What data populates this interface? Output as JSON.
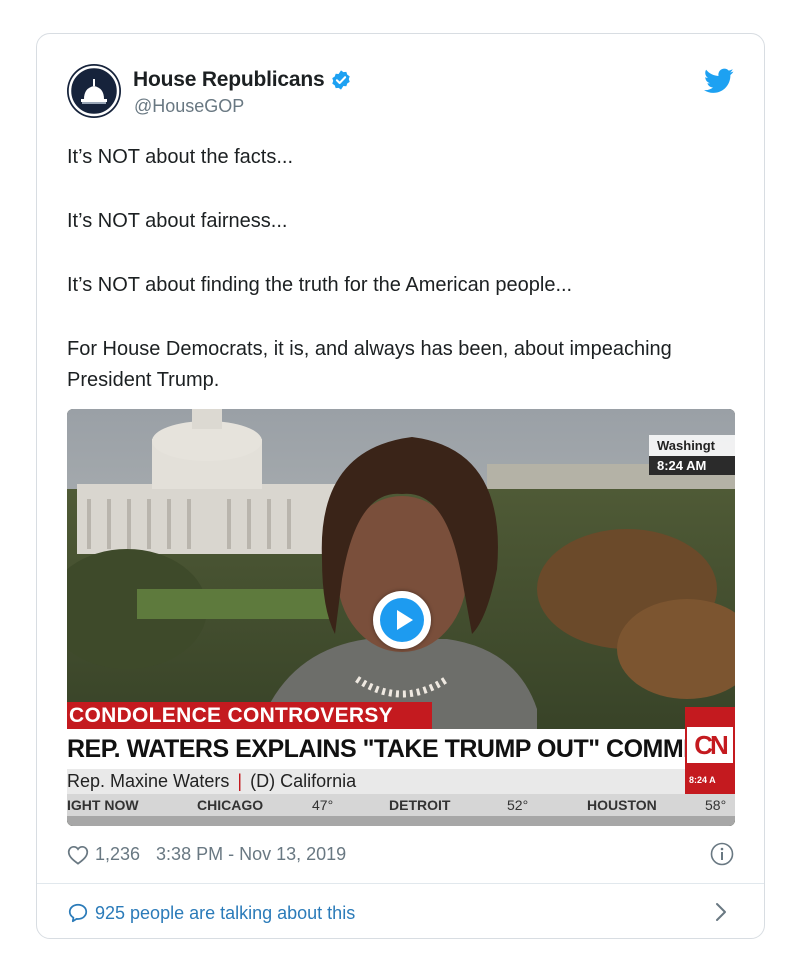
{
  "account": {
    "name": "House Republicans",
    "handle": "@HouseGOP",
    "verified": true,
    "avatar_icon": "capitol-dome-icon"
  },
  "tweet": {
    "paragraphs": [
      "It’s NOT about the facts...",
      "It’s NOT about fairness...",
      "It’s NOT about finding the truth for the American people...",
      "For House Democrats, it is, and always has been, about impeaching President Trump."
    ]
  },
  "video": {
    "location": "Washingt",
    "location_time": "8:24 AM",
    "banner_red": "CONDOLENCE CONTROVERSY",
    "headline": "REP. WATERS EXPLAINS \"TAKE TRUMP OUT\" COMMENT",
    "sub_name": "Rep. Maxine Waters",
    "sub_party": "(D) California",
    "cnn_logo": "CN",
    "cnn_time": "8:24 A",
    "ticker": [
      "IGHT NOW",
      "CHICAGO",
      "47°",
      "DETROIT",
      "52°",
      "HOUSTON",
      "58°"
    ],
    "play_icon": "play-icon"
  },
  "meta": {
    "likes": "1,236",
    "timestamp": "3:38 PM - Nov 13, 2019"
  },
  "footer": {
    "talking": "925 people are talking about this"
  },
  "colors": {
    "link_blue": "#2b7bb9",
    "twitter_blue": "#1da1f2",
    "verified_blue": "#1da1f2",
    "cnn_red": "#c41a1f",
    "muted": "#697882"
  }
}
